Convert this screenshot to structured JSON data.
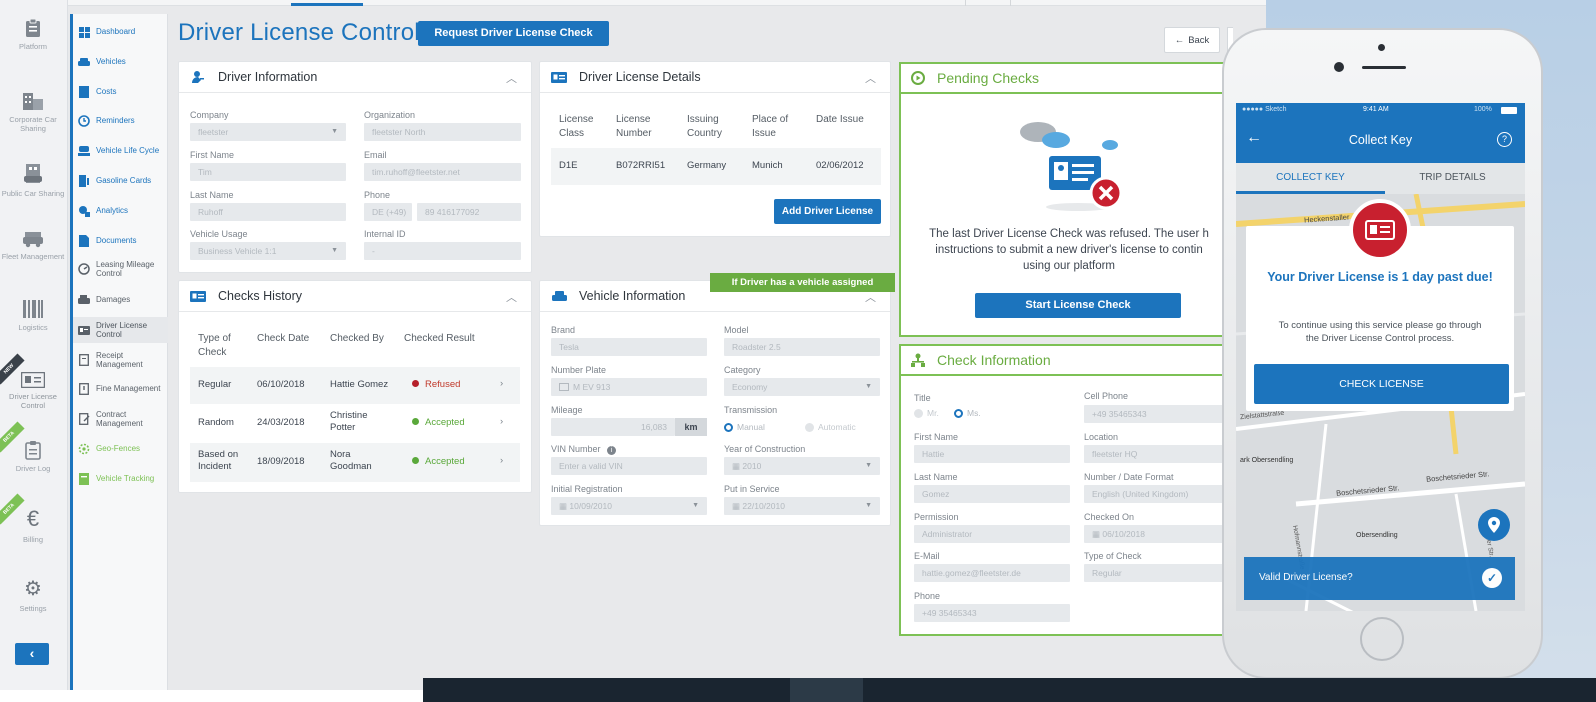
{
  "rail": {
    "items": [
      {
        "label": "Platform",
        "icon": "clipboard-icon"
      },
      {
        "label": "Corporate Car Sharing",
        "icon": "buildings-icon"
      },
      {
        "label": "Public Car Sharing",
        "icon": "car-building-icon"
      },
      {
        "label": "Fleet Management",
        "icon": "car-icon"
      },
      {
        "label": "Logistics",
        "icon": "barcode-icon"
      },
      {
        "label": "Driver License Control",
        "icon": "id-card-icon",
        "ribbon": "NEW"
      },
      {
        "label": "Driver Log",
        "icon": "clipboard-icon",
        "ribbon": "BETA"
      },
      {
        "label": "Billing",
        "icon": "euro-icon",
        "ribbon": "BETA"
      },
      {
        "label": "Settings",
        "icon": "gear-icon"
      }
    ],
    "collapse_label": "‹"
  },
  "nav": {
    "items": [
      "Dashboard",
      "Vehicles",
      "Costs",
      "Reminders",
      "Vehicle Life Cycle",
      "Gasoline Cards",
      "Analytics",
      "Documents",
      "Leasing Mileage Control",
      "Damages",
      "Driver License Control",
      "Receipt Management",
      "Fine Management",
      "Contract Management",
      "Geo-Fences",
      "Vehicle Tracking"
    ]
  },
  "page": {
    "title": "Driver License Control",
    "request_button": "Request Driver License Check",
    "back_button": "Back"
  },
  "driver_info": {
    "title": "Driver Information",
    "company_label": "Company",
    "company_value": "fleetster",
    "organization_label": "Organization",
    "organization_value": "fleetster North",
    "first_name_label": "First Name",
    "first_name_value": "Tim",
    "email_label": "Email",
    "email_value": "tim.ruhoff@fleetster.net",
    "last_name_label": "Last Name",
    "last_name_value": "Ruhoff",
    "phone_label": "Phone",
    "phone_prefix": "DE (+49)",
    "phone_value": "89 416177092",
    "usage_label": "Vehicle Usage",
    "usage_value": "Business Vehicle 1:1",
    "internal_label": "Internal ID",
    "internal_value": "-"
  },
  "license_details": {
    "title": "Driver License Details",
    "headers": [
      "License Class",
      "License Number",
      "Issuing Country",
      "Place of Issue",
      "Date Issue"
    ],
    "row": [
      "D1E",
      "B072RRI51",
      "Germany",
      "Munich",
      "02/06/2012"
    ],
    "add_button": "Add Driver License"
  },
  "pending": {
    "title": "Pending Checks",
    "message": "The last Driver License Check was refused. The user has to follow the instructions to submit a new driver's license to continue using our platform",
    "message_line1": "The last Driver License Check was refused. The user h",
    "message_line2": "instructions to submit a new driver's license to contin",
    "message_line3": "using our platform",
    "button": "Start License Check"
  },
  "checks_history": {
    "title": "Checks History",
    "headers": [
      "Type of Check",
      "Check Date",
      "Checked By",
      "Checked Result"
    ],
    "rows": [
      {
        "type": "Regular",
        "date": "06/10/2018",
        "by": "Hattie Gomez",
        "result": "Refused",
        "status_color": "#c0392b"
      },
      {
        "type": "Random",
        "date": "24/03/2018",
        "by": "Christine Potter",
        "result": "Accepted",
        "status_color": "#5aa83a"
      },
      {
        "type": "Based on Incident",
        "date": "18/09/2018",
        "by": "Nora Goodman",
        "result": "Accepted",
        "status_color": "#5aa83a"
      }
    ]
  },
  "vehicle_info": {
    "title": "Vehicle Information",
    "tag": "If Driver has a vehicle assigned",
    "brand_label": "Brand",
    "brand_value": "Tesla",
    "model_label": "Model",
    "model_value": "Roadster 2.5",
    "plate_label": "Number Plate",
    "plate_value": "M EV 913",
    "category_label": "Category",
    "category_value": "Economy",
    "mileage_label": "Mileage",
    "mileage_value": "16,083",
    "mileage_unit": "km",
    "transmission_label": "Transmission",
    "transmission_manual": "Manual",
    "transmission_auto": "Automatic",
    "vin_label": "VIN Number",
    "vin_placeholder": "Enter a valid VIN",
    "year_label": "Year of Construction",
    "year_value": "2010",
    "initial_label": "Initial Registration",
    "initial_value": "10/09/2010",
    "service_label": "Put in Service",
    "service_value": "22/10/2010"
  },
  "check_info": {
    "title": "Check Information",
    "title_label": "Title",
    "mr": "Mr.",
    "ms": "Ms.",
    "cell_label": "Cell Phone",
    "cell_value": "+49 35465343",
    "first_label": "First Name",
    "first_value": "Hattie",
    "location_label": "Location",
    "location_value": "fleetster HQ",
    "last_label": "Last Name",
    "last_value": "Gomez",
    "format_label": "Number / Date Format",
    "format_value": "English (United Kingdom)",
    "permission_label": "Permission",
    "permission_value": "Administrator",
    "checked_on_label": "Checked On",
    "checked_on_value": "06/10/2018",
    "email_label": "E-Mail",
    "email_value": "hattie.gomez@fleetster.de",
    "type_label": "Type of Check",
    "type_value": "Regular",
    "phone_label": "Phone",
    "phone_value": "+49 35465343"
  },
  "phone": {
    "status_carrier": "●●●●● Sketch",
    "status_time": "9:41 AM",
    "status_battery": "100%",
    "header_title": "Collect Key",
    "tab_collect": "COLLECT KEY",
    "tab_trip": "TRIP DETAILS",
    "map_labels": [
      "Heckenstaller",
      "Zielstattstraße",
      "ark Obersendling",
      "Boschetsrieder Str.",
      "Boschetsrieder Str.",
      "Obersendling",
      "Hofmannstraße",
      "Tölzer Str."
    ],
    "modal_title": "Your Driver License is 1 day past due!",
    "modal_text": "To continue using this service please go through the Driver License Control process.",
    "modal_button": "CHECK LICENSE",
    "bottom_text": "Valid Driver License?"
  },
  "colors": {
    "accent": "#1c74bd",
    "success": "#7dc155",
    "danger": "#c8202f"
  }
}
